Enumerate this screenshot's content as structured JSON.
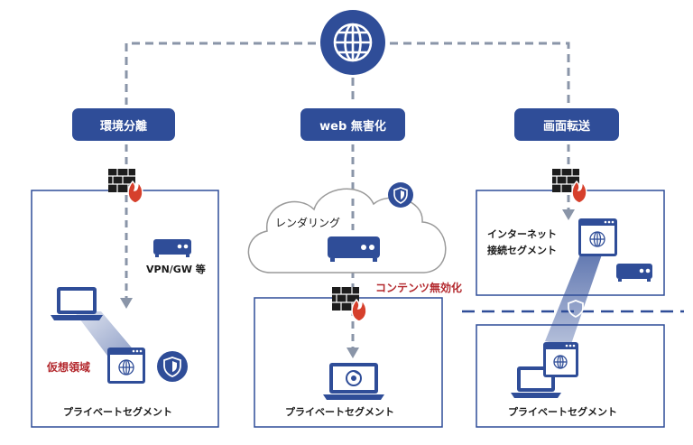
{
  "approaches": {
    "left": "環境分離",
    "center": "web 無害化",
    "right": "画面転送"
  },
  "left_panel": {
    "vpn_label": "VPN/GW 等",
    "virtual_label": "仮想領域",
    "segment_label": "プライベートセグメント"
  },
  "center_panel": {
    "rendering_label": "レンダリング",
    "neutralize_label": "コンテンツ無効化",
    "segment_label": "プライベートセグメント"
  },
  "right_panel": {
    "internet_segment_label": "インターネット\n接続セグメント",
    "internet_segment_line1": "インターネット",
    "internet_segment_line2": "接続セグメント",
    "segment_label": "プライベートセグメント"
  },
  "colors": {
    "navy": "#2f4d98",
    "dash": "#8a95a8",
    "fire": "#d6402c",
    "label_red": "#b3282d"
  },
  "icons": [
    "globe-icon",
    "firewall-icon",
    "server-icon",
    "laptop-icon",
    "browser-window-icon",
    "shield-icon",
    "cloud-icon",
    "chrome-icon"
  ]
}
